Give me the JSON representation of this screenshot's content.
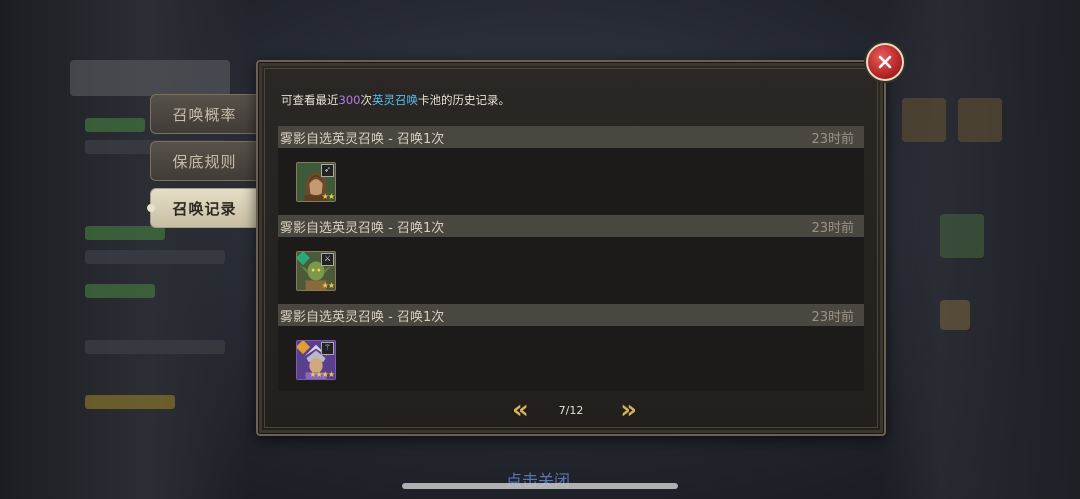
{
  "tabs": [
    {
      "label": "召唤概率"
    },
    {
      "label": "保底规则"
    },
    {
      "label": "召唤记录",
      "active": true
    }
  ],
  "intro": {
    "prefix": "可查看最近",
    "count": "300",
    "mid": "次",
    "pool": "英灵召唤",
    "suffix": "卡池的历史记录。"
  },
  "records": [
    {
      "title": "雾影自选英灵召唤 - 召唤1次",
      "time": "23时前",
      "hero": {
        "icon": "hooded-archer-portrait",
        "class_icon": "bow-icon",
        "stars": "★★",
        "frame": "#8a7a58"
      }
    },
    {
      "title": "雾影自选英灵召唤 - 召唤1次",
      "time": "23时前",
      "hero": {
        "icon": "goblin-warrior-portrait",
        "class_icon": "crossed-swords-icon",
        "element_color": "#2aa87a",
        "stars": "★★",
        "frame": "#8a7a58"
      }
    },
    {
      "title": "雾影自选英灵召唤 - 召唤1次",
      "time": "23时前",
      "hero": {
        "icon": "winged-helm-mage-portrait",
        "class_icon": "staff-icon",
        "element_color": "#e0a030",
        "stars": "★★★★",
        "frame": "#7b5bb5"
      }
    }
  ],
  "pager": {
    "current": "7/12",
    "prev_icon": "double-chevron-left-icon",
    "next_icon": "double-chevron-right-icon"
  },
  "footer": {
    "close_hint": "点击关闭"
  },
  "colors": {
    "accent_purple": "#b07de8",
    "accent_blue": "#57c0f0",
    "gold": "#d8b25a"
  }
}
